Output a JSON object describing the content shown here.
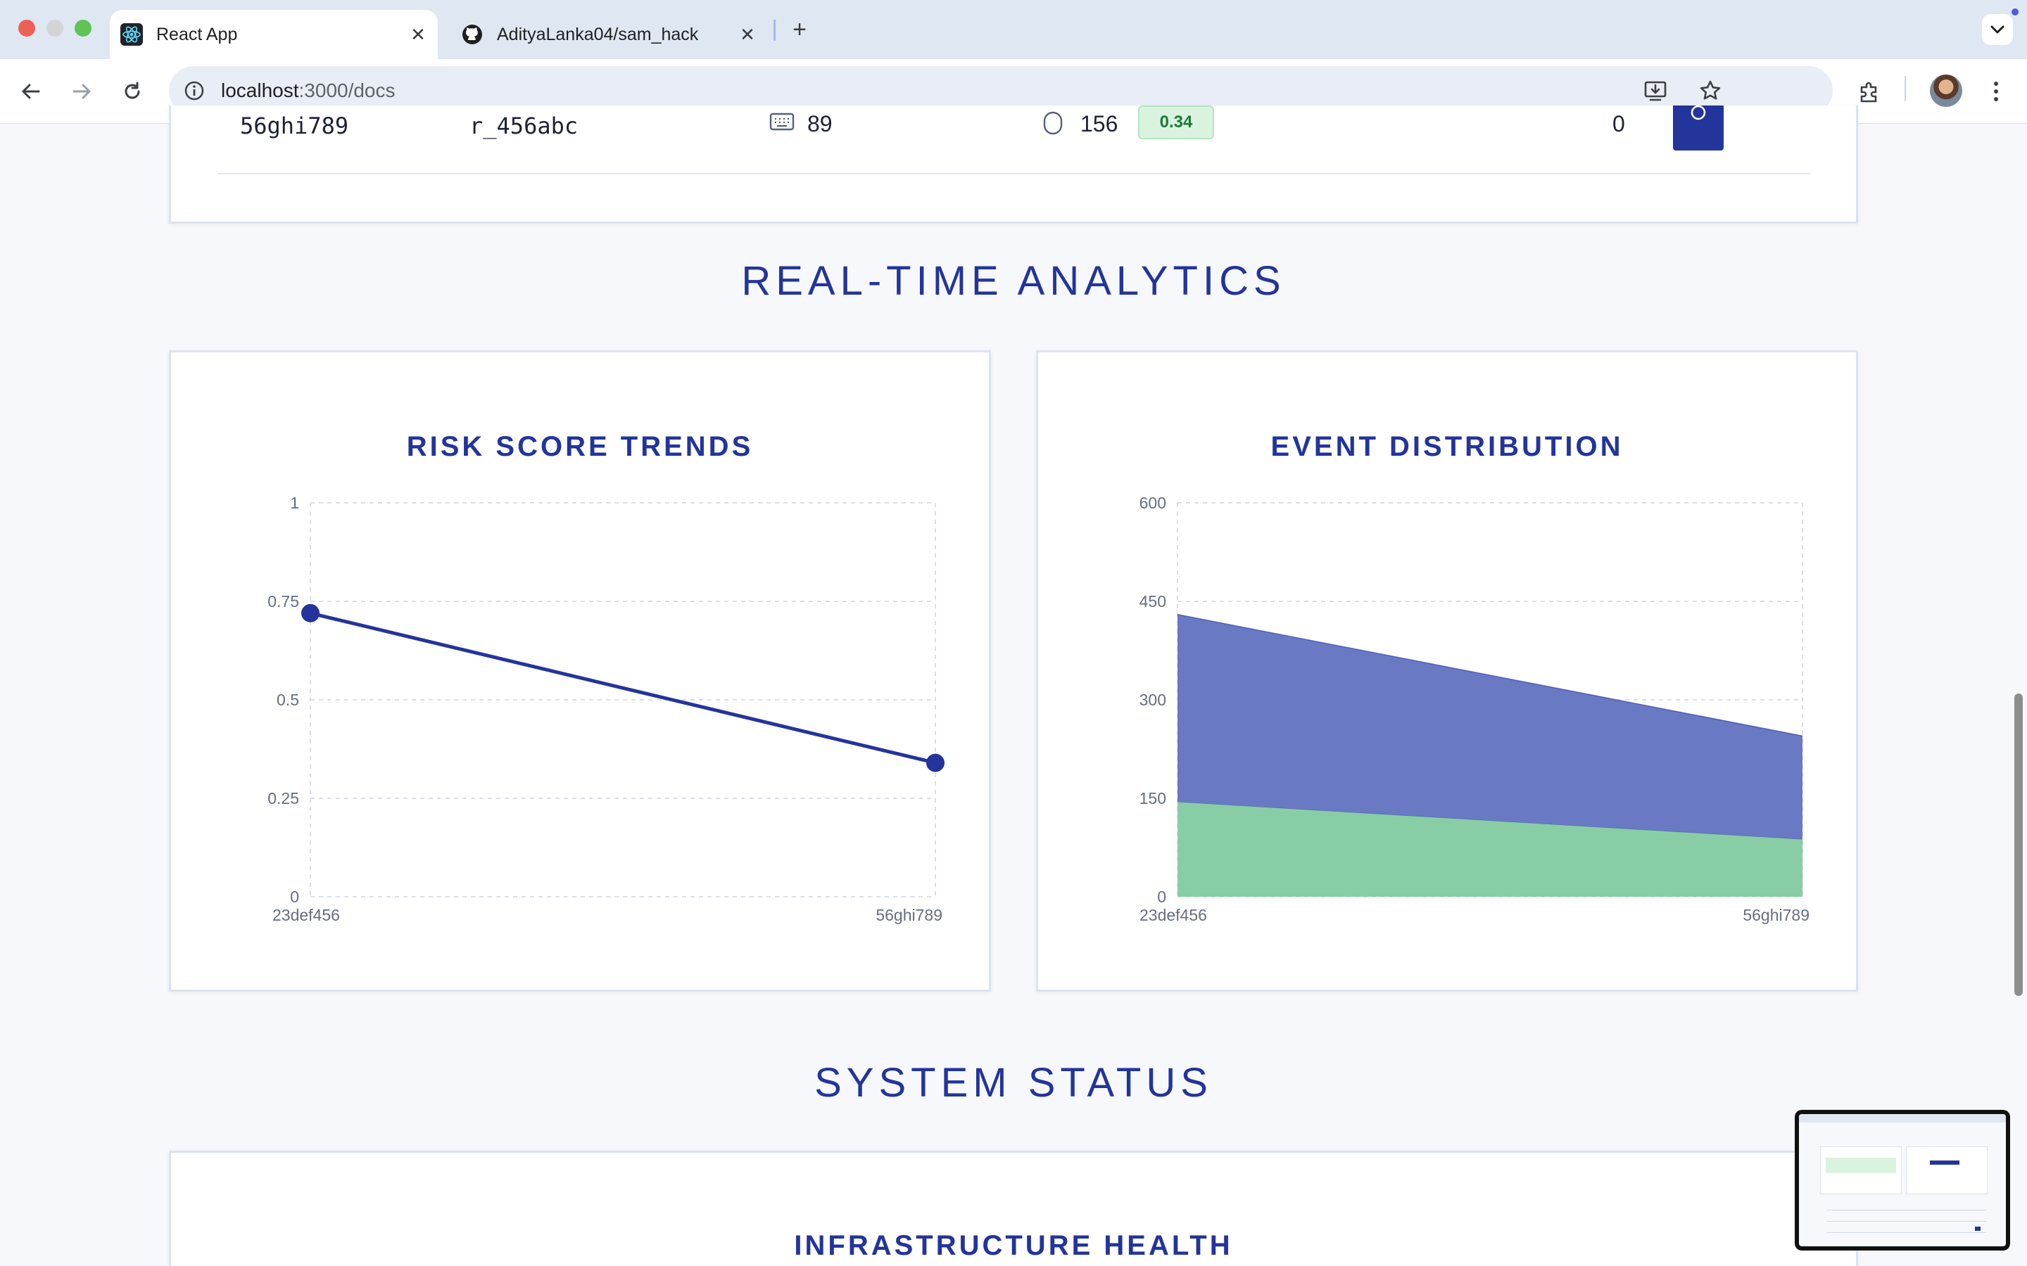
{
  "browser": {
    "tabs": [
      {
        "title": "React App",
        "icon": "react-logo-icon",
        "active": true
      },
      {
        "title": "AdityaLanka04/sam_hack",
        "icon": "github-icon",
        "active": false
      }
    ],
    "url_host": "localhost",
    "url_path": ":3000/docs"
  },
  "session_row": {
    "session_id": "56ghi789",
    "user_id": "r_456abc",
    "keystrokes": "89",
    "clicks": "156",
    "risk_score": "0.34",
    "anomalies": "0"
  },
  "sections": {
    "analytics_title": "REAL-TIME ANALYTICS",
    "status_title": "SYSTEM STATUS",
    "infra_title": "INFRASTRUCTURE HEALTH"
  },
  "colors": {
    "accent": "#23349b",
    "area_blue": "#6a79c4",
    "area_green": "#89cda6",
    "badge_green": "#d9f3df"
  },
  "chart_data": [
    {
      "type": "line",
      "title": "RISK SCORE TRENDS",
      "x": [
        "23def456",
        "56ghi789"
      ],
      "series": [
        {
          "values": [
            0.72,
            0.34
          ]
        }
      ],
      "ylim": [
        0,
        1
      ],
      "yticks": [
        "0",
        "0.25",
        "0.5",
        "0.75",
        "1"
      ],
      "grid": true
    },
    {
      "type": "area",
      "title": "EVENT DISTRIBUTION",
      "x": [
        "23def456",
        "56ghi789"
      ],
      "series": [
        {
          "values": [
            145,
            88
          ],
          "color": "#89cda6"
        },
        {
          "values": [
            285,
            157
          ],
          "color": "#6a79c4"
        }
      ],
      "stacked": true,
      "ylim": [
        0,
        600
      ],
      "yticks": [
        "0",
        "150",
        "300",
        "450",
        "600"
      ],
      "grid": true
    }
  ]
}
